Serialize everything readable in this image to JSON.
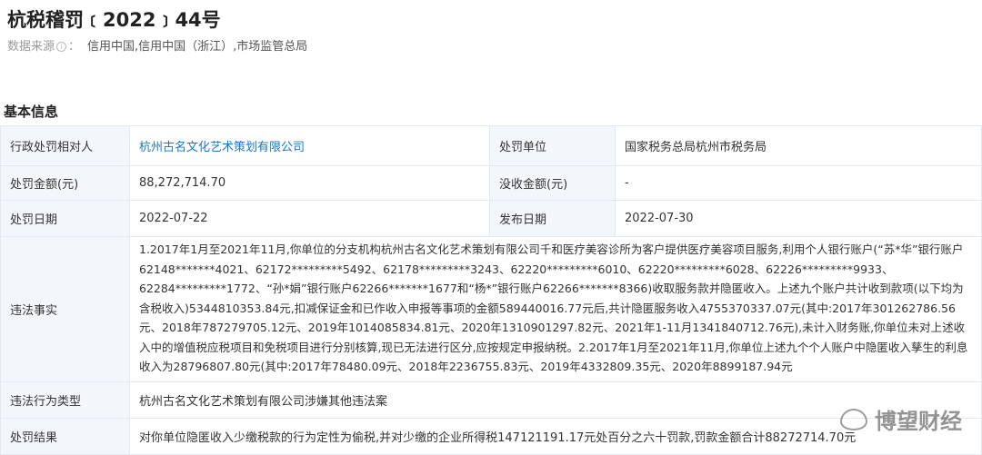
{
  "header": {
    "title": "杭税稽罚﹝2022﹞44号",
    "source_label": "数据来源",
    "source_sep": "：",
    "source_value": "信用中国,信用中国（浙江）,市场监管总局"
  },
  "section_title": "基本信息",
  "rows": [
    {
      "l1": "行政处罚相对人",
      "v1": "杭州古名文化艺术策划有限公司",
      "l2": "处罚单位",
      "v2": "国家税务总局杭州市税务局"
    },
    {
      "l1": "处罚金额(元)",
      "v1": "88,272,714.70",
      "l2": "没收金额(元)",
      "v2": "-"
    },
    {
      "l1": "处罚日期",
      "v1": "2022-07-22",
      "l2": "发布日期",
      "v2": "2022-07-30"
    }
  ],
  "facts": {
    "label": "违法事实",
    "value": "1.2017年1月至2021年11月,你单位的分支机构杭州古名文化艺术策划有限公司千和医疗美容诊所为客户提供医疗美容项目服务,利用个人银行账户(“苏*华”银行账户62148*******4021、62172*********5492、62178*********3243、62220*********6010、62220*********6028、62226*********9933、62284*********1772、“孙*娟”银行账户62266*******1677和“杨*”银行账户62266*******8366)收取服务款并隐匿收入。上述九个账户共计收到款项(以下均为含税收入)5344810353.84元,扣减保证金和已作收入申报等事项的金额589440016.77元后,共计隐匿服务收入4755370337.07元(其中:2017年301262786.56元、2018年787279705.12元、2019年1014085834.81元、2020年1310901297.82元、2021年1-11月1341840712.76元),未计入财务账,你单位未对上述收入中的增值税应税项目和免税项目进行分别核算,现已无法进行区分,应按规定申报纳税。2.2017年1月至2021年11月,你单位上述九个个人账户中隐匿收入孳生的利息收入为28796807.80元(其中:2017年78480.09元、2018年2236755.83元、2019年4332809.35元、2020年8899187.94元"
  },
  "type": {
    "label": "违法行为类型",
    "value": "杭州古名文化艺术策划有限公司涉嫌其他违法案"
  },
  "result": {
    "label": "处罚结果",
    "value": "对你单位隐匿收入少缴税款的行为定性为偷税,并对少缴的企业所得税147121191.17元处百分之六十罚款,罚款金额合计88272714.70元"
  },
  "watermark": "博望财经"
}
